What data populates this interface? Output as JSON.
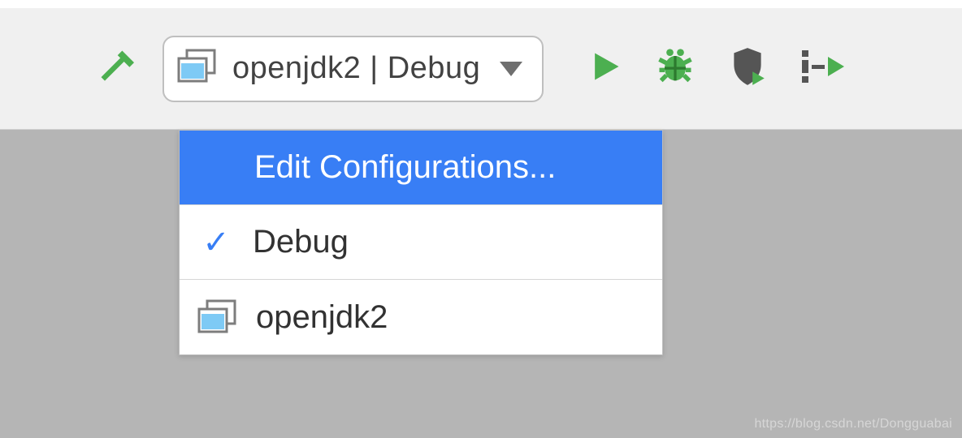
{
  "toolbar": {
    "config_label": "openjdk2 | Debug"
  },
  "dropdown": {
    "edit_label": "Edit Configurations...",
    "debug_label": "Debug",
    "project_label": "openjdk2"
  },
  "watermark": "https://blog.csdn.net/Dongguabai"
}
